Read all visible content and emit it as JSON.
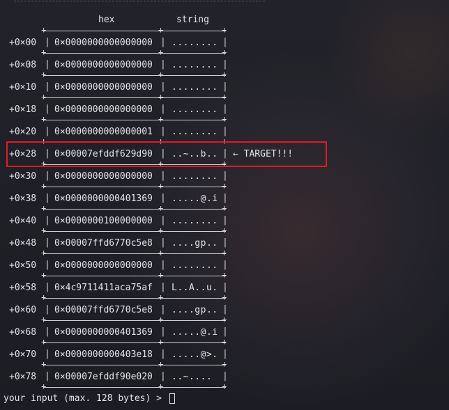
{
  "headers": {
    "hex": "hex",
    "string": "string"
  },
  "rows": [
    {
      "offset": "+0×00",
      "hex": "0×0000000000000000",
      "string": "........"
    },
    {
      "offset": "+0×08",
      "hex": "0×0000000000000000",
      "string": "........"
    },
    {
      "offset": "+0×10",
      "hex": "0×0000000000000000",
      "string": "........"
    },
    {
      "offset": "+0×18",
      "hex": "0×0000000000000000",
      "string": "........"
    },
    {
      "offset": "+0×20",
      "hex": "0×0000000000000001",
      "string": "........"
    },
    {
      "offset": "+0×28",
      "hex": "0×00007efddf629d90",
      "string": "..~..b..",
      "note": "← TARGET!!!"
    },
    {
      "offset": "+0×30",
      "hex": "0×0000000000000000",
      "string": "........"
    },
    {
      "offset": "+0×38",
      "hex": "0×0000000000401369",
      "string": ".....@.i"
    },
    {
      "offset": "+0×40",
      "hex": "0×0000000100000000",
      "string": "........"
    },
    {
      "offset": "+0×48",
      "hex": "0×00007ffd6770c5e8",
      "string": "....gp.."
    },
    {
      "offset": "+0×50",
      "hex": "0×0000000000000000",
      "string": "........"
    },
    {
      "offset": "+0×58",
      "hex": "0×4c9711411aca75af",
      "string": "L..A..u."
    },
    {
      "offset": "+0×60",
      "hex": "0×00007ffd6770c5e8",
      "string": "....gp.."
    },
    {
      "offset": "+0×68",
      "hex": "0×0000000000401369",
      "string": ".....@.i"
    },
    {
      "offset": "+0×70",
      "hex": "0×0000000000403e18",
      "string": ".....@>."
    },
    {
      "offset": "+0×78",
      "hex": "0×00007efddf90e020",
      "string": "..~...."
    }
  ],
  "prompt": "your input (max. 128 bytes) >",
  "colors": {
    "highlight": "#e01b24",
    "background": "#1f2027",
    "text": "#e4e4ea"
  }
}
